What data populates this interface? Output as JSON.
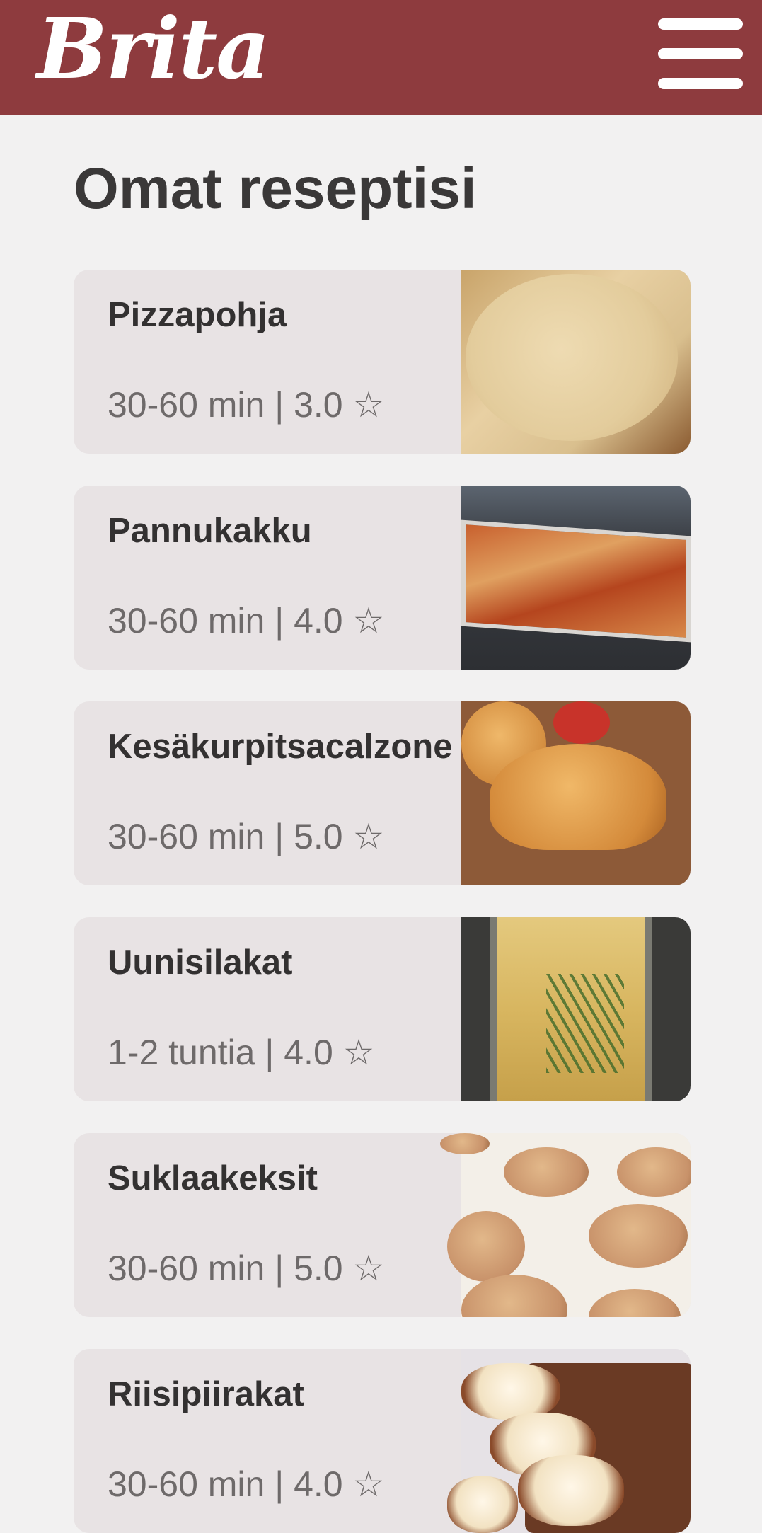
{
  "header": {
    "logo_text": "Brita",
    "menu_icon": "hamburger-menu-icon",
    "background_color": "#8e3b3e"
  },
  "page": {
    "title": "Omat reseptisi"
  },
  "recipes": [
    {
      "name": "Pizzapohja",
      "meta": "30-60 min | 3.0 ☆",
      "image": "pizza-dough-photo"
    },
    {
      "name": "Pannukakku",
      "meta": "30-60 min | 4.0 ☆",
      "image": "oven-pancake-photo"
    },
    {
      "name": "Kesäkurpitsacalzone",
      "meta": "30-60 min | 5.0 ☆",
      "image": "calzone-photo"
    },
    {
      "name": "Uunisilakat",
      "meta": "1-2 tuntia | 4.0 ☆",
      "image": "baked-herring-photo"
    },
    {
      "name": "Suklaakeksit",
      "meta": "30-60 min | 5.0 ☆",
      "image": "chocolate-cookies-photo"
    },
    {
      "name": "Riisipiirakat",
      "meta": "30-60 min | 4.0 ☆",
      "image": "rice-pies-photo"
    }
  ]
}
